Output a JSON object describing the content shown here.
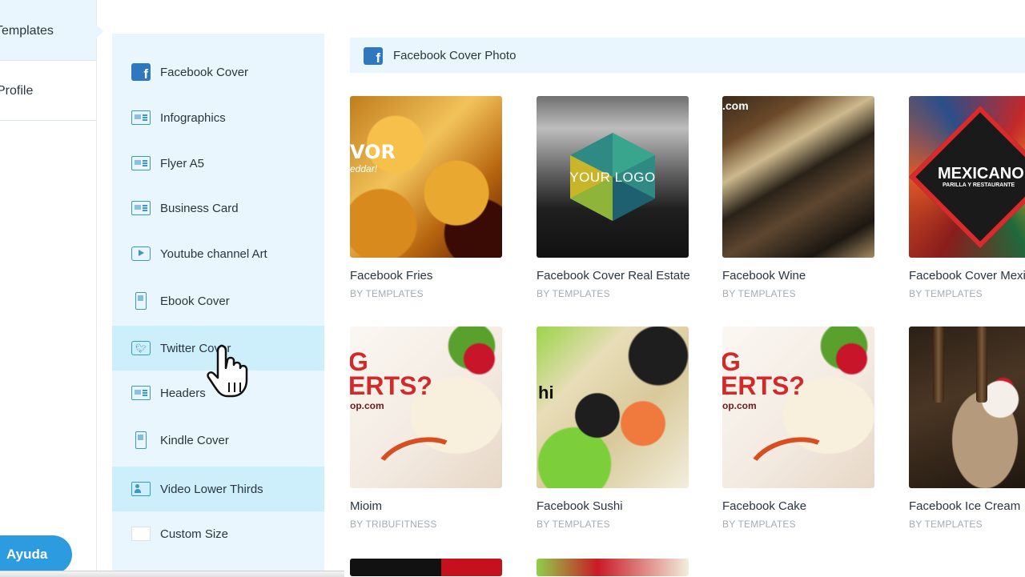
{
  "left_nav": {
    "items": [
      {
        "label": "Templates",
        "active": true
      },
      {
        "label": "Profile",
        "active": false
      }
    ]
  },
  "categories": {
    "items": [
      {
        "label": "Facebook Cover",
        "icon": "facebook-icon"
      },
      {
        "label": "Infographics",
        "icon": "infographic-icon"
      },
      {
        "label": "Flyer A5",
        "icon": "flyer-icon"
      },
      {
        "label": "Business Card",
        "icon": "business-card-icon"
      },
      {
        "label": "Youtube channel Art",
        "icon": "youtube-icon"
      },
      {
        "label": "Ebook Cover",
        "icon": "ebook-icon"
      },
      {
        "label": "Twitter Cover",
        "icon": "twitter-icon"
      },
      {
        "label": "Headers",
        "icon": "header-icon"
      },
      {
        "label": "Kindle Cover",
        "icon": "kindle-icon"
      },
      {
        "label": "Video Lower Thirds",
        "icon": "video-lower-thirds-icon"
      },
      {
        "label": "Custom Size",
        "icon": "custom-size-icon"
      }
    ],
    "hovered": "Twitter Cover",
    "selected": "Video Lower Thirds"
  },
  "section": {
    "title": "Facebook Cover Photo",
    "icon": "facebook-icon"
  },
  "templates": [
    {
      "title": "Facebook Fries",
      "author": "BY TEMPLATES",
      "thumb_text": [
        "VOR",
        "eddar!"
      ]
    },
    {
      "title": "Facebook Cover Real Estate",
      "author": "BY TEMPLATES",
      "thumb_text": [
        "YOUR LOGO"
      ]
    },
    {
      "title": "Facebook Wine",
      "author": "BY TEMPLATES",
      "thumb_text": [
        ".com"
      ]
    },
    {
      "title": "Facebook Cover Mexi",
      "author": "BY TEMPLATES",
      "thumb_text": [
        "MEXICANO",
        "PARILLA Y RESTAURANTE"
      ]
    },
    {
      "title": "Mioim",
      "author": "BY TRIBUFITNESS",
      "thumb_text": [
        "G",
        "ERTS?",
        "op.com"
      ]
    },
    {
      "title": "Facebook Sushi",
      "author": "BY TEMPLATES",
      "thumb_text": [
        "hi"
      ]
    },
    {
      "title": "Facebook Cake",
      "author": "BY TEMPLATES",
      "thumb_text": [
        "G",
        "ERTS?",
        "op.com"
      ]
    },
    {
      "title": "Facebook Ice Cream",
      "author": "BY TEMPLATES",
      "thumb_text": []
    }
  ],
  "help_button": {
    "label": "Ayuda"
  },
  "colors": {
    "panel_bg": "#e9f6fd",
    "hover_bg": "#cdeefb",
    "icon_blue": "#3b97c9",
    "facebook_blue": "#2f78c0",
    "help_blue": "#2c9be0",
    "muted_text": "#a3abb3"
  }
}
